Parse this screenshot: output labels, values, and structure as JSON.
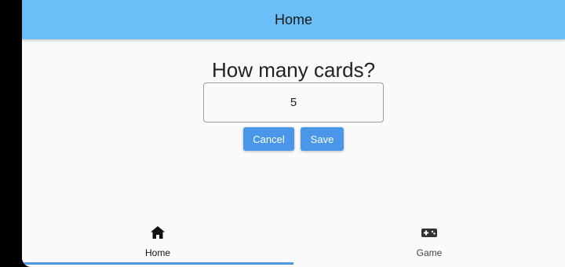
{
  "app_bar": {
    "title": "Home"
  },
  "main": {
    "question": "How many cards?",
    "card_count_value": "5",
    "cancel_label": "Cancel",
    "save_label": "Save"
  },
  "bottom_nav": {
    "items": [
      {
        "label": "Home",
        "icon": "home-icon",
        "selected": true
      },
      {
        "label": "Game",
        "icon": "gamepad-icon",
        "selected": false
      }
    ]
  },
  "colors": {
    "app_bar": "#6abff8",
    "button": "#4a97ea",
    "background": "#fafafa"
  }
}
